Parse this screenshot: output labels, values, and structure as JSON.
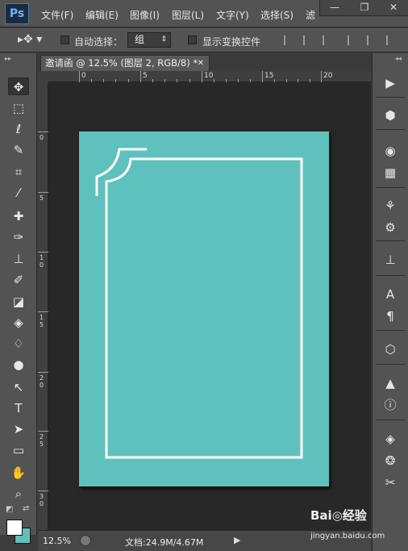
{
  "app": {
    "logo": "Ps"
  },
  "menu": [
    "文件(F)",
    "编辑(E)",
    "图像(I)",
    "图层(L)",
    "文字(Y)",
    "选择(S)",
    "滤"
  ],
  "window_controls": {
    "minimize": "—",
    "restore": "❐",
    "close": "✕"
  },
  "options": {
    "auto_select_label": "自动选择：",
    "auto_select_value": "组",
    "transform_label": "显示变换控件"
  },
  "document": {
    "tab_title": "邀请函 @ 12.5% (图层 2, RGB/8) *",
    "close": "✕"
  },
  "rulers": {
    "top": [
      "0",
      "5",
      "10",
      "15",
      "20"
    ],
    "left": [
      "0",
      "5",
      "1 0",
      "1 5",
      "2 0",
      "2 5",
      "3 0"
    ]
  },
  "status": {
    "zoom": "12.5%",
    "doc_info": "文档:24.9M/4.67M",
    "arrow": "▶"
  },
  "colors": {
    "canvas": "#5fc1bd",
    "frame": "#ffffff",
    "foreground": "#ffffff",
    "background": "#5fc1bd"
  },
  "tools": [
    "move-tool",
    "marquee-tool",
    "lasso-tool",
    "quick-select-tool",
    "crop-tool",
    "eyedropper-tool",
    "healing-brush-tool",
    "brush-tool",
    "clone-stamp-tool",
    "history-brush-tool",
    "eraser-tool",
    "paint-bucket-tool",
    "blur-tool",
    "dodge-tool",
    "pen-tool",
    "type-tool",
    "path-select-tool",
    "rectangle-tool",
    "hand-tool",
    "zoom-tool"
  ],
  "watermark": {
    "brand": "Bai◎经验",
    "url": "jingyan.baidu.com"
  }
}
